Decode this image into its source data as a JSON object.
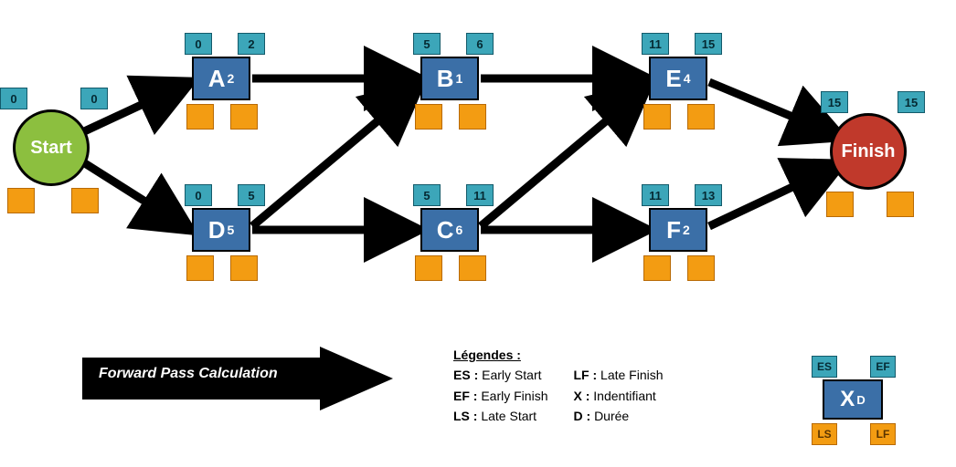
{
  "chart_data": {
    "type": "diagram",
    "title": "Forward Pass Calculation",
    "nodes": [
      {
        "id": "Start",
        "type": "start",
        "label": "Start",
        "es": 0,
        "ef": 0,
        "ls": null,
        "lf": null
      },
      {
        "id": "A",
        "type": "activity",
        "label": "A",
        "duration": 2,
        "es": 0,
        "ef": 2,
        "ls": null,
        "lf": null
      },
      {
        "id": "B",
        "type": "activity",
        "label": "B",
        "duration": 1,
        "es": 5,
        "ef": 6,
        "ls": null,
        "lf": null
      },
      {
        "id": "E",
        "type": "activity",
        "label": "E",
        "duration": 4,
        "es": 11,
        "ef": 15,
        "ls": null,
        "lf": null
      },
      {
        "id": "D",
        "type": "activity",
        "label": "D",
        "duration": 5,
        "es": 0,
        "ef": 5,
        "ls": null,
        "lf": null
      },
      {
        "id": "C",
        "type": "activity",
        "label": "C",
        "duration": 6,
        "es": 5,
        "ef": 11,
        "ls": null,
        "lf": null
      },
      {
        "id": "F",
        "type": "activity",
        "label": "F",
        "duration": 2,
        "es": 11,
        "ef": 13,
        "ls": null,
        "lf": null
      },
      {
        "id": "Finish",
        "type": "finish",
        "label": "Finish",
        "es": 15,
        "ef": 15,
        "ls": null,
        "lf": null
      }
    ],
    "edges": [
      [
        "Start",
        "A"
      ],
      [
        "Start",
        "D"
      ],
      [
        "A",
        "B"
      ],
      [
        "D",
        "B"
      ],
      [
        "D",
        "C"
      ],
      [
        "B",
        "E"
      ],
      [
        "C",
        "E"
      ],
      [
        "C",
        "F"
      ],
      [
        "E",
        "Finish"
      ],
      [
        "F",
        "Finish"
      ]
    ]
  },
  "legend": {
    "title": "Légendes :",
    "items": [
      {
        "abbr": "ES",
        "desc": "Early Start"
      },
      {
        "abbr": "EF",
        "desc": "Early Finish"
      },
      {
        "abbr": "LS",
        "desc": "Late Start"
      },
      {
        "abbr": "LF",
        "desc": "Late Finish"
      },
      {
        "abbr": "X",
        "desc": "Indentifiant"
      },
      {
        "abbr": "D",
        "desc": "Durée"
      }
    ],
    "sample": {
      "name": "X",
      "duration": "D",
      "es": "ES",
      "ef": "EF",
      "ls": "LS",
      "lf": "LF"
    }
  },
  "arrow_label": "Forward Pass Calculation"
}
